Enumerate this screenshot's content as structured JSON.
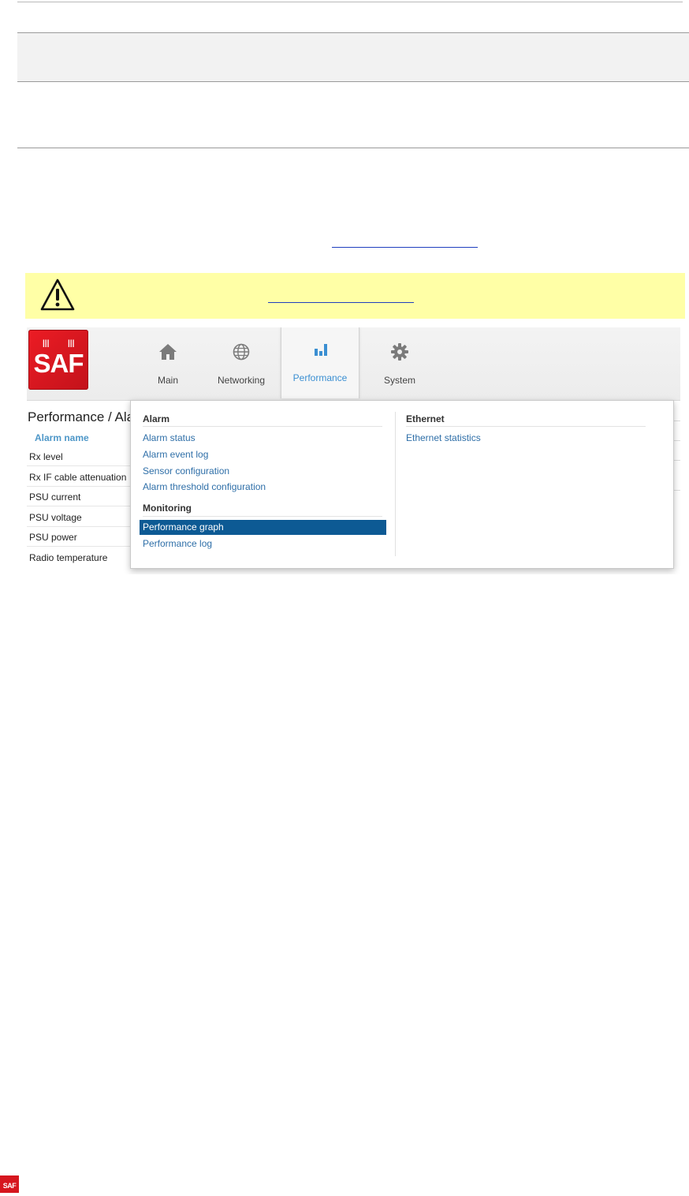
{
  "nav": {
    "tabs": [
      {
        "label": "Main",
        "icon": "home-icon"
      },
      {
        "label": "Networking",
        "icon": "globe-icon"
      },
      {
        "label": "Performance",
        "icon": "bar-chart-icon"
      },
      {
        "label": "System",
        "icon": "gear-icon"
      }
    ],
    "active_tab": "Performance",
    "logo_text": "SAF"
  },
  "page": {
    "title": "Performance / Ala",
    "column_header": "Alarm name",
    "rows": [
      "Rx level",
      "Rx IF cable attenuation",
      "PSU current",
      "PSU voltage",
      "PSU power",
      "Radio temperature"
    ]
  },
  "dropdown": {
    "alarm": {
      "heading": "Alarm",
      "items": [
        "Alarm status",
        "Alarm event log",
        "Sensor configuration",
        "Alarm threshold configuration"
      ]
    },
    "monitoring": {
      "heading": "Monitoring",
      "items": [
        "Performance graph",
        "Performance log"
      ],
      "selected": "Performance graph"
    },
    "ethernet": {
      "heading": "Ethernet",
      "items": [
        "Ethernet statistics"
      ]
    }
  },
  "colors": {
    "accent": "#3b8fd2",
    "selected_bg": "#0d5a94",
    "link": "#2f6fa8",
    "logo_red": "#e31b23",
    "warning_bg": "#ffffa6"
  },
  "footer": {
    "logo_text": "SAF"
  }
}
